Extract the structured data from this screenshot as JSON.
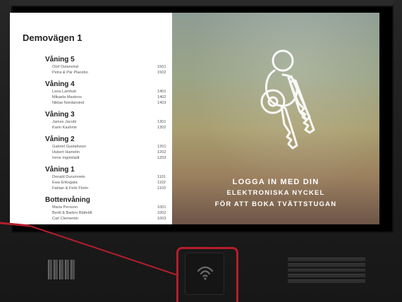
{
  "directory": {
    "building": "Demovägen 1",
    "floors": [
      {
        "name": "Våning 5",
        "residents": [
          {
            "name": "Olof Ostanvind",
            "apt": "1501"
          },
          {
            "name": "Petra & Pär Placebo",
            "apt": "1502"
          }
        ]
      },
      {
        "name": "Våning 4",
        "residents": [
          {
            "name": "Lena Lamhult",
            "apt": "1401"
          },
          {
            "name": "Mikaela Maskros",
            "apt": "1402"
          },
          {
            "name": "Niklas Nordanvind",
            "apt": "1403"
          }
        ]
      },
      {
        "name": "Våning 3",
        "residents": [
          {
            "name": "James Jacobi",
            "apt": "1301"
          },
          {
            "name": "Karin Kashmir",
            "apt": "1302"
          }
        ]
      },
      {
        "name": "Våning 2",
        "residents": [
          {
            "name": "Gabriel Gustafsson",
            "apt": "1201"
          },
          {
            "name": "Hubert Hamelin",
            "apt": "1202"
          },
          {
            "name": "Irene Ingolstadt",
            "apt": "1203"
          }
        ]
      },
      {
        "name": "Våning 1",
        "residents": [
          {
            "name": "Donald Durumvete",
            "apt": "1101"
          },
          {
            "name": "Ewa Eriksgata",
            "apt": "1102"
          },
          {
            "name": "Fabian & Felix Florin",
            "apt": "1103"
          }
        ]
      },
      {
        "name": "Bottenvåning",
        "residents": [
          {
            "name": "Maria Persson",
            "apt": "1001"
          },
          {
            "name": "Bertil & Barbro Bläfeldt",
            "apt": "1002"
          },
          {
            "name": "Carl Clementin",
            "apt": "1003"
          }
        ]
      }
    ]
  },
  "promo": {
    "line1": "Logga in med din",
    "line2": "elektroniska nyckel",
    "line3": "för att boka tvättstugan"
  },
  "icons": {
    "keys": "keys-icon",
    "nfc": "nfc-icon"
  },
  "colors": {
    "highlight": "#b51e2a"
  }
}
